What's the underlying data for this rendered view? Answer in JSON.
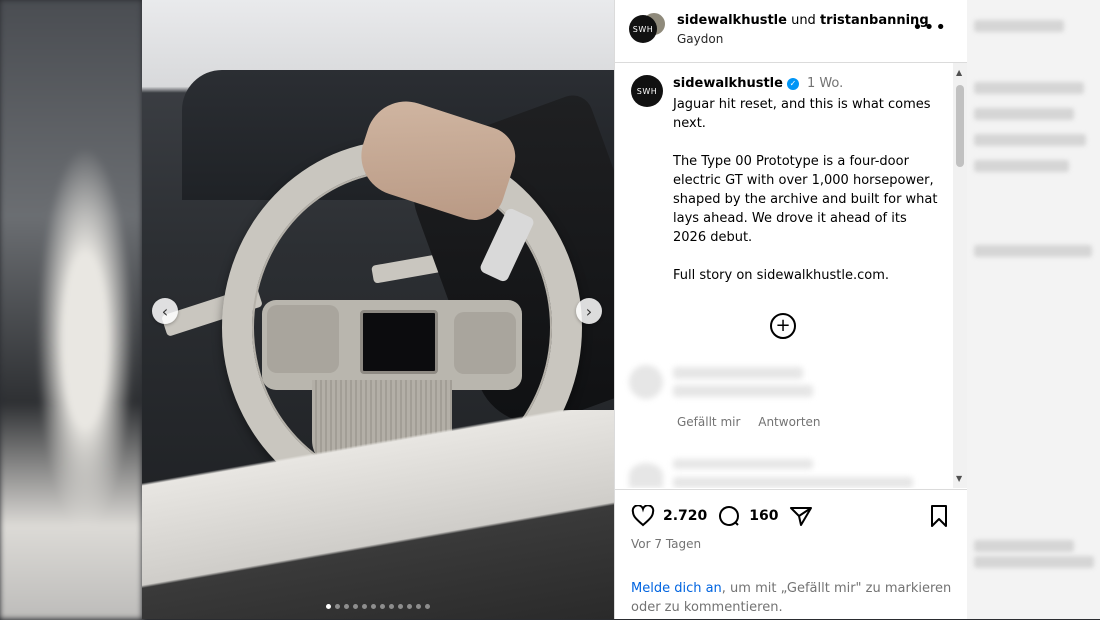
{
  "header": {
    "user1": "sidewalkhustle",
    "joiner": "und",
    "user2": "tristanbanning",
    "location": "Gaydon",
    "more_icon": "ellipsis-icon"
  },
  "caption": {
    "username": "sidewalkhustle",
    "time": "1 Wo.",
    "text": "Jaguar hit reset, and this is what comes next.\n\nThe Type 00 Prototype is a four-door electric GT with over 1,000 horsepower, shaped by the archive and built for what lays ahead. We drove it ahead of its 2026 debut.\n\nFull story on sidewalkhustle.com."
  },
  "comments": {
    "like_label": "Gefällt mir",
    "reply_label": "Antworten"
  },
  "actions": {
    "likes": "2.720",
    "comments": "160",
    "posted": "Vor 7 Tagen"
  },
  "login": {
    "link": "Melde dich an",
    "rest": ", um mit „Gefällt mir\" zu markieren oder zu kommentieren."
  },
  "colors": {
    "accent": "#0095f6",
    "link": "#0064e0",
    "muted": "#737373"
  }
}
